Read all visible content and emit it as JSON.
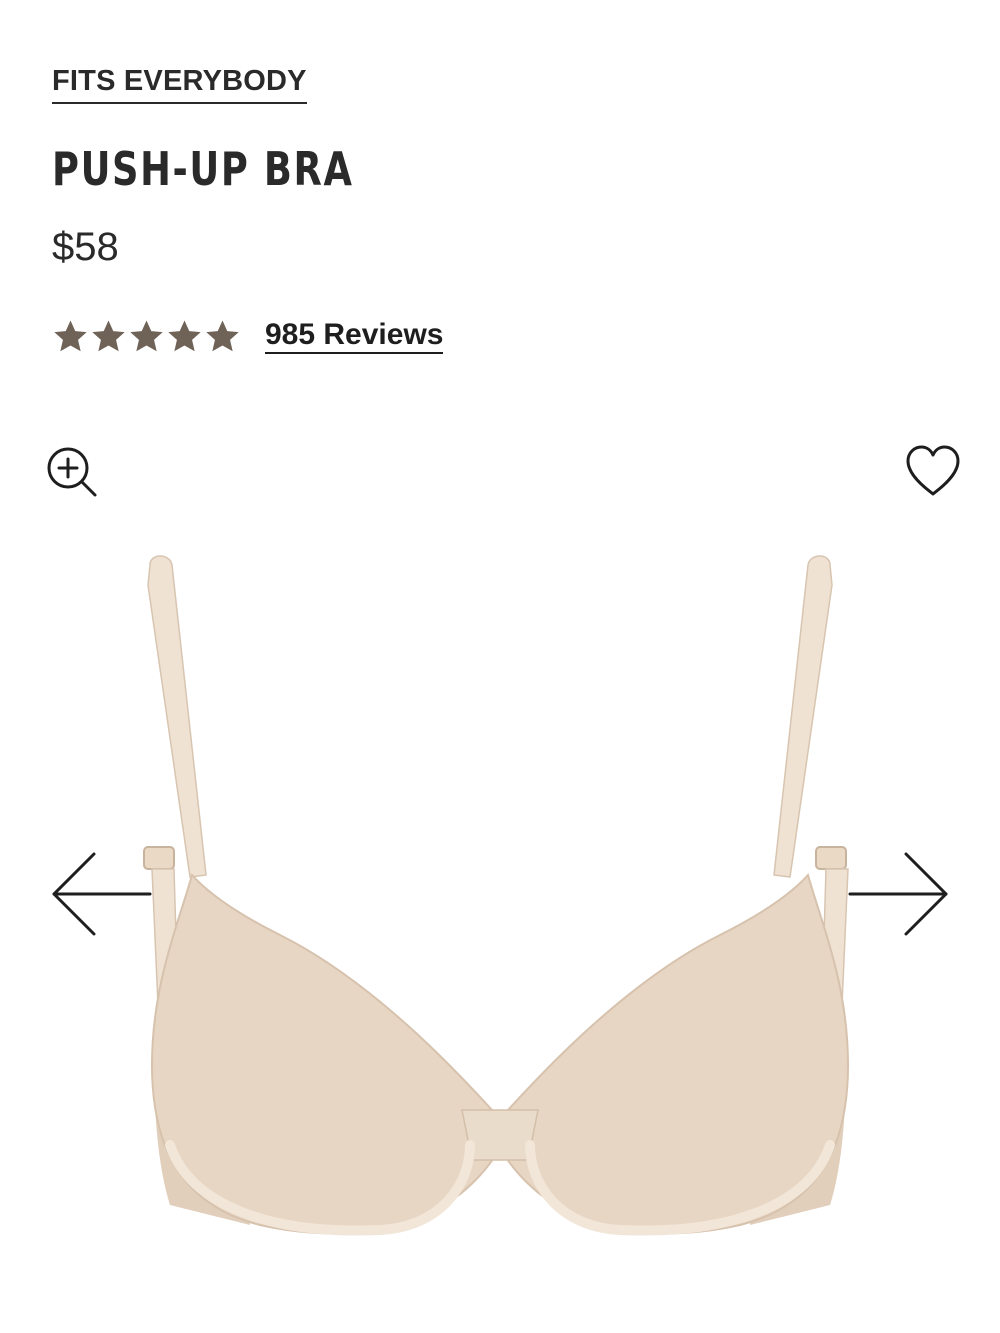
{
  "collection": {
    "label": "FITS EVERYBODY"
  },
  "product": {
    "title": "PUSH-UP BRA",
    "price": "$58",
    "product_color": "#e8d6c4"
  },
  "rating": {
    "stars": 5,
    "max_stars": 5,
    "reviews_label": "985 Reviews",
    "star_color": "#6f6257"
  },
  "icons": {
    "zoom": "zoom-in-icon",
    "wishlist": "heart-icon",
    "previous": "arrow-left-icon",
    "next": "arrow-right-icon"
  }
}
